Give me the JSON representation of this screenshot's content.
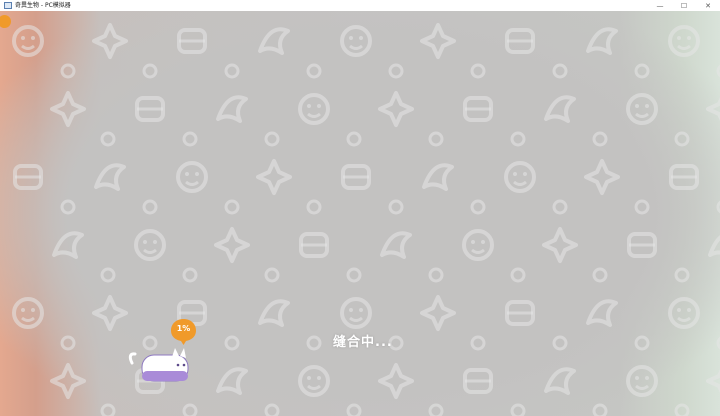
{
  "window": {
    "title": "奇異生物 - PC模拟器",
    "controls": {
      "minimize": "—",
      "maximize": "☐",
      "close": "✕"
    }
  },
  "game": {
    "loading_text": "缝合中...",
    "progress_label": "1%",
    "progress": 0.01,
    "accent_color": "#f09a2a",
    "cat_color": "#a98bd8"
  }
}
